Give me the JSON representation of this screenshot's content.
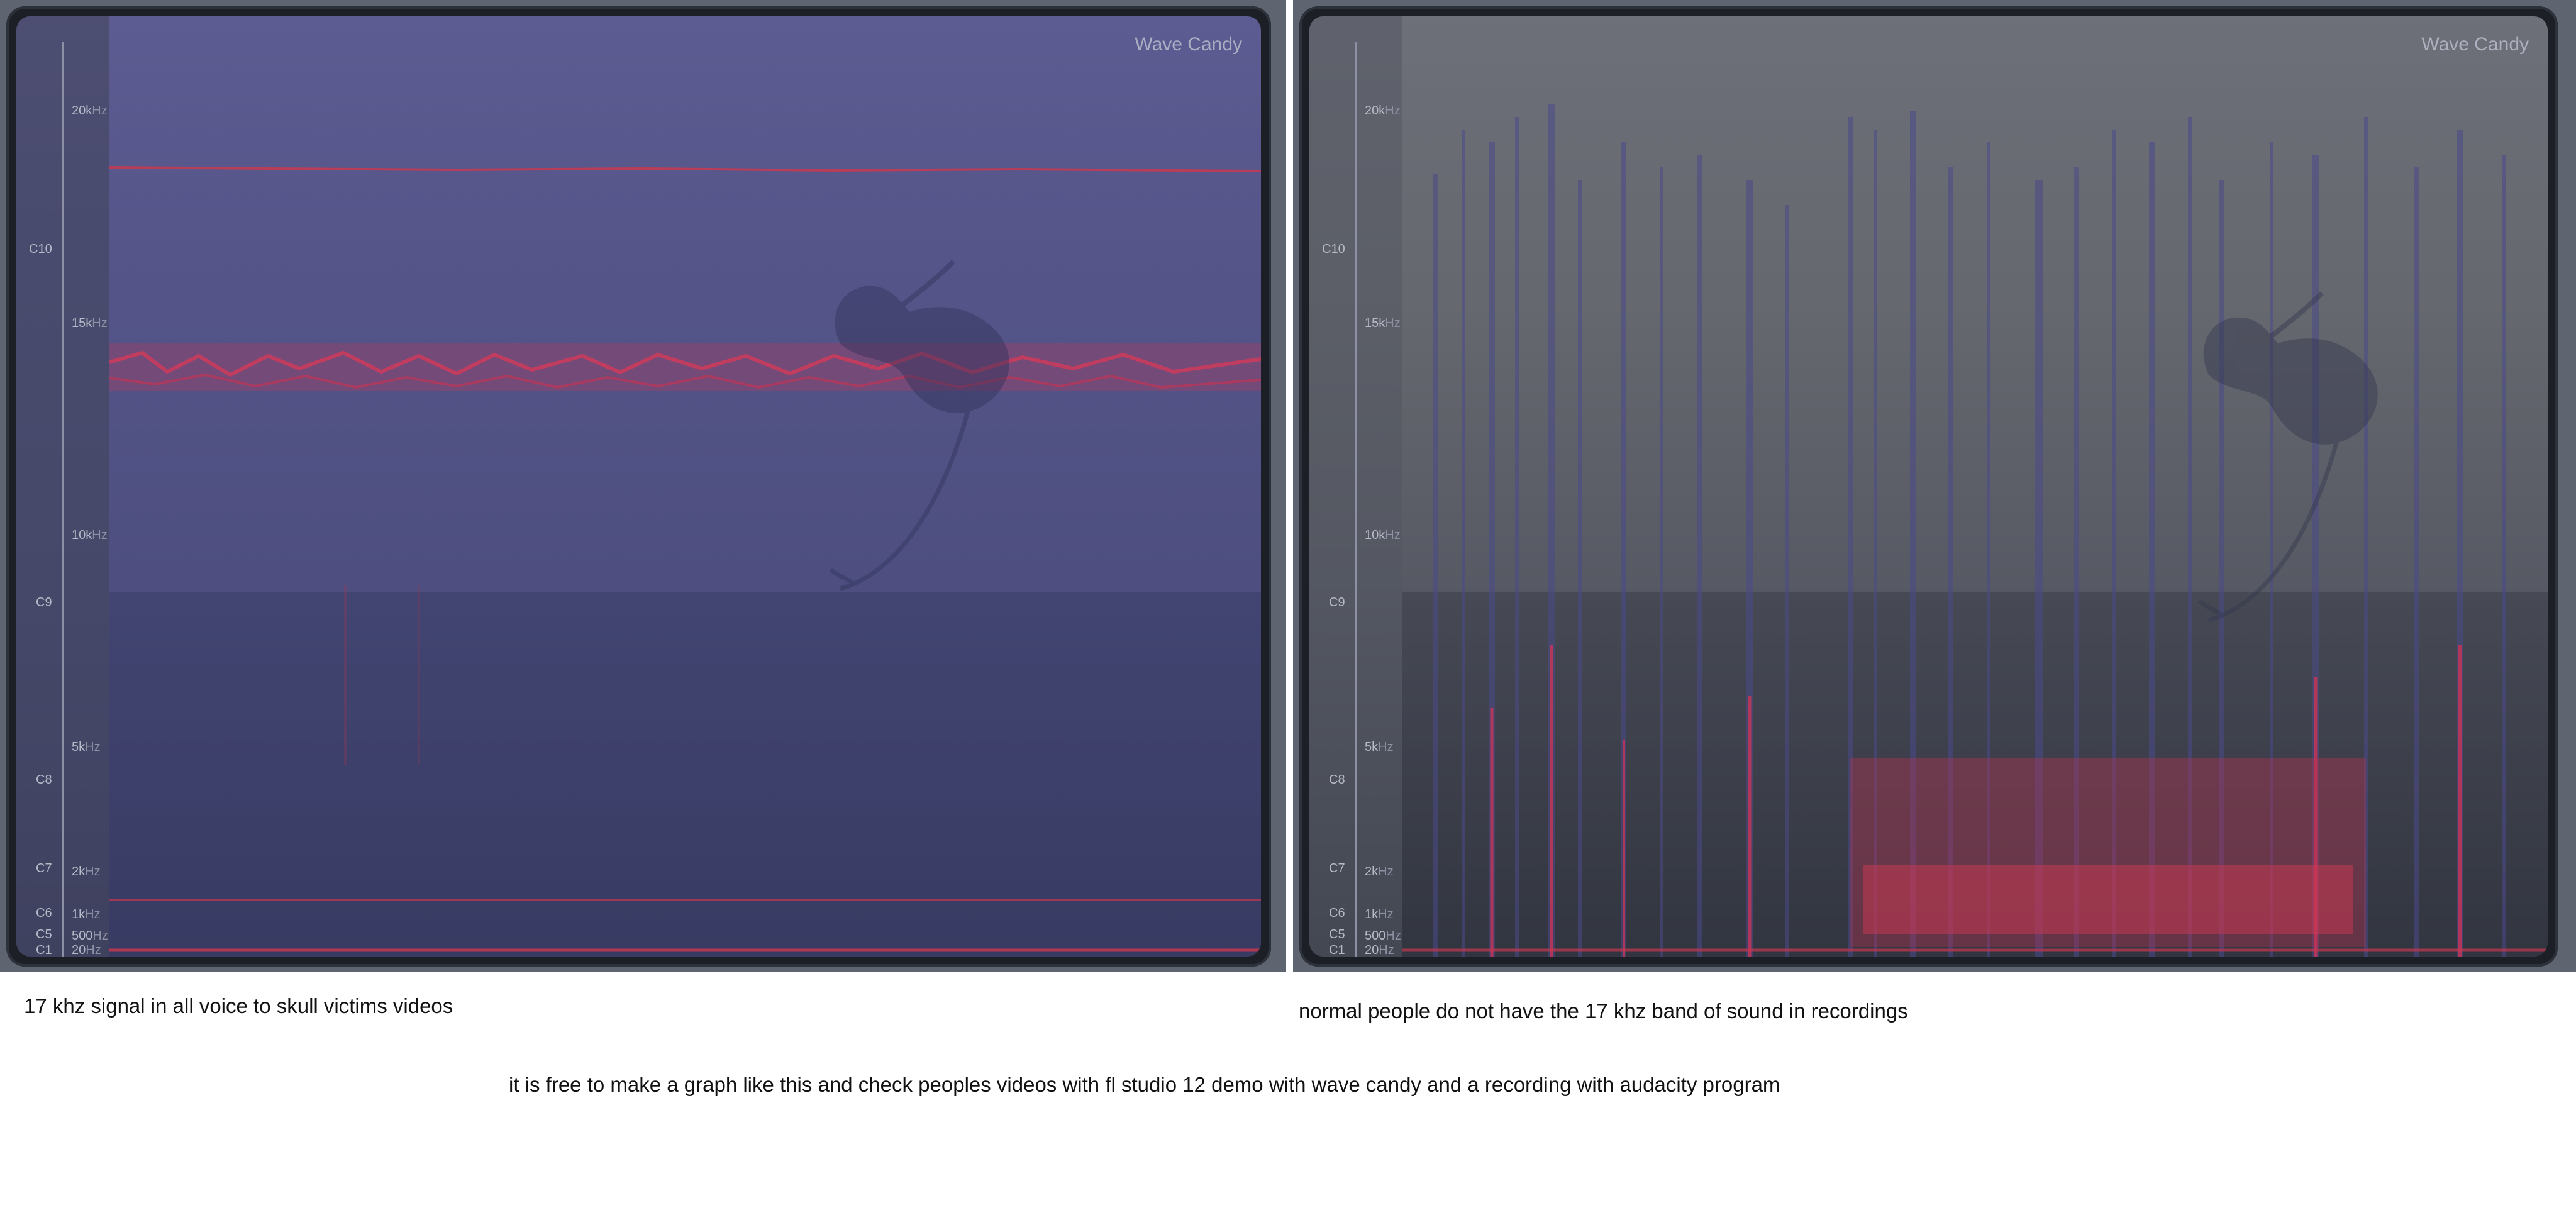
{
  "panels": [
    {
      "title": "Wave Candy",
      "freq_labels": [
        {
          "value": "20k",
          "unit": "Hz"
        },
        {
          "value": "15k",
          "unit": "Hz"
        },
        {
          "value": "10k",
          "unit": "Hz"
        },
        {
          "value": "5k",
          "unit": "Hz"
        },
        {
          "value": "2k",
          "unit": "Hz"
        },
        {
          "value": "1k",
          "unit": "Hz"
        },
        {
          "value": "500",
          "unit": "Hz"
        },
        {
          "value": "20",
          "unit": "Hz"
        }
      ],
      "note_labels": [
        "C10",
        "C9",
        "C8",
        "C7",
        "C6",
        "C5",
        "C1"
      ]
    },
    {
      "title": "Wave Candy",
      "freq_labels": [
        {
          "value": "20k",
          "unit": "Hz"
        },
        {
          "value": "15k",
          "unit": "Hz"
        },
        {
          "value": "10k",
          "unit": "Hz"
        },
        {
          "value": "5k",
          "unit": "Hz"
        },
        {
          "value": "2k",
          "unit": "Hz"
        },
        {
          "value": "1k",
          "unit": "Hz"
        },
        {
          "value": "500",
          "unit": "Hz"
        },
        {
          "value": "20",
          "unit": "Hz"
        }
      ],
      "note_labels": [
        "C10",
        "C9",
        "C8",
        "C7",
        "C6",
        "C5",
        "C1"
      ]
    }
  ],
  "captions": {
    "left": "17 khz signal in all voice to skull victims videos",
    "right": "normal people do not have the 17 khz band of sound in recordings",
    "bottom": "it is free to make a graph like this and check peoples videos with fl studio 12 demo with wave candy and a recording with audacity program"
  },
  "colors": {
    "spectrum_blue": "#55558a",
    "spectrum_gray": "#66686f",
    "signal_red": "#e0324e",
    "frame": "#5e6470",
    "bezel": "#1c1f25"
  },
  "icons": [
    "fl-studio-fruit-logo-icon"
  ]
}
